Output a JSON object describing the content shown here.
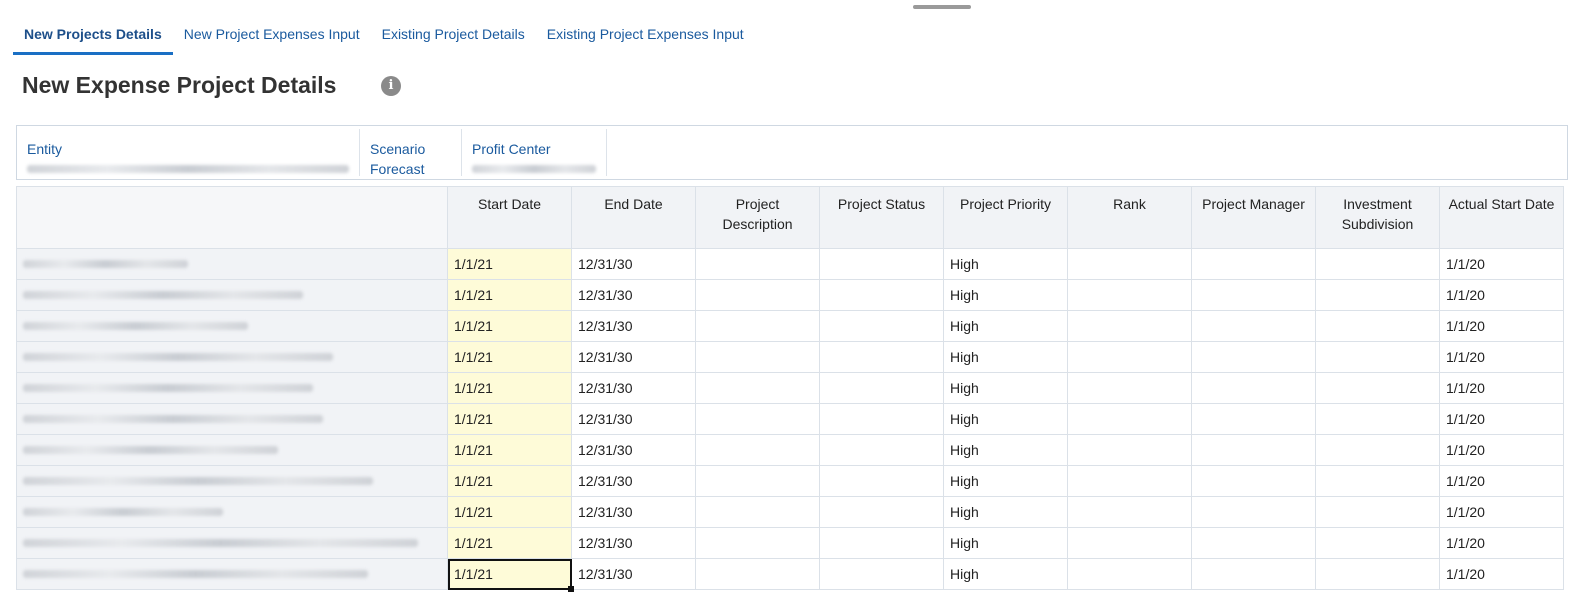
{
  "tabs": [
    {
      "label": "New Projects Details",
      "active": true
    },
    {
      "label": "New Project Expenses Input"
    },
    {
      "label": "Existing Project Details"
    },
    {
      "label": "Existing Project Expenses Input"
    }
  ],
  "page_title": "New Expense Project Details",
  "pov": {
    "entity_label": "Entity",
    "scenario_label": "Scenario",
    "scenario_value": "Forecast",
    "profit_center_label": "Profit Center"
  },
  "columns": [
    "Start Date",
    "End Date",
    "Project Description",
    "Project Status",
    "Project Priority",
    "Rank",
    "Project Manager",
    "Investment Subdivision",
    "Actual Start Date"
  ],
  "rows": [
    [
      "1/1/21",
      "12/31/30",
      "",
      "",
      "High",
      "",
      "",
      "",
      "1/1/20"
    ],
    [
      "1/1/21",
      "12/31/30",
      "",
      "",
      "High",
      "",
      "",
      "",
      "1/1/20"
    ],
    [
      "1/1/21",
      "12/31/30",
      "",
      "",
      "High",
      "",
      "",
      "",
      "1/1/20"
    ],
    [
      "1/1/21",
      "12/31/30",
      "",
      "",
      "High",
      "",
      "",
      "",
      "1/1/20"
    ],
    [
      "1/1/21",
      "12/31/30",
      "",
      "",
      "High",
      "",
      "",
      "",
      "1/1/20"
    ],
    [
      "1/1/21",
      "12/31/30",
      "",
      "",
      "High",
      "",
      "",
      "",
      "1/1/20"
    ],
    [
      "1/1/21",
      "12/31/30",
      "",
      "",
      "High",
      "",
      "",
      "",
      "1/1/20"
    ],
    [
      "1/1/21",
      "12/31/30",
      "",
      "",
      "High",
      "",
      "",
      "",
      "1/1/20"
    ],
    [
      "1/1/21",
      "12/31/30",
      "",
      "",
      "High",
      "",
      "",
      "",
      "1/1/20"
    ],
    [
      "1/1/21",
      "12/31/30",
      "",
      "",
      "High",
      "",
      "",
      "",
      "1/1/20"
    ],
    [
      "1/1/21",
      "12/31/30",
      "",
      "",
      "High",
      "",
      "",
      "",
      "1/1/20"
    ]
  ]
}
